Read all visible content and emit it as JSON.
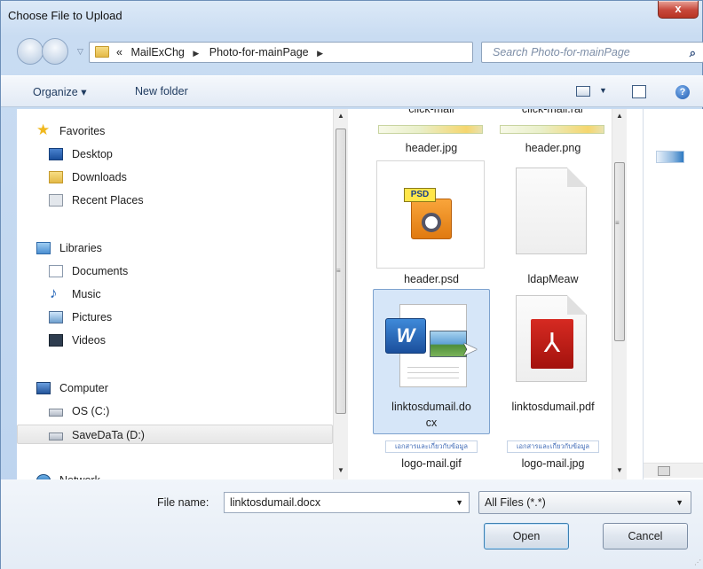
{
  "window": {
    "title": "Choose File to Upload",
    "close_glyph": "x"
  },
  "address": {
    "crumbs": [
      "«",
      "MailExChg",
      "Photo-for-mainPage"
    ],
    "search_placeholder": "Search Photo-for-mainPage"
  },
  "toolbar": {
    "organize": "Organize ▾",
    "new_folder": "New folder",
    "help": "?"
  },
  "navpane": {
    "favorites": "Favorites",
    "desktop": "Desktop",
    "downloads": "Downloads",
    "recent": "Recent Places",
    "libraries": "Libraries",
    "documents": "Documents",
    "music": "Music",
    "pictures": "Pictures",
    "videos": "Videos",
    "computer": "Computer",
    "os_c": "OS (C:)",
    "savedata": "SaveDaTa (D:)",
    "network": "Network"
  },
  "files": {
    "partial_top_1": "click-mail",
    "partial_top_2": "click-mail.rar",
    "header_jpg": "header.jpg",
    "header_png": "header.png",
    "header_psd": "header.psd",
    "psd_tag": "PSD",
    "ldapmeaw": "ldapMeaw",
    "docx_line1": "linktosdumail.do",
    "docx_line2": "cx",
    "pdf": "linktosdumail.pdf",
    "logo_gif": "logo-mail.gif",
    "logo_jpg": "logo-mail.jpg",
    "logo_strip_text": "เอกสารและเกี่ยวกับข้อมูล"
  },
  "footer": {
    "file_name_label": "File name:",
    "file_name_value": "linktosdumail.docx",
    "file_type_value": "All Files (*.*)",
    "open": "Open",
    "cancel": "Cancel"
  }
}
